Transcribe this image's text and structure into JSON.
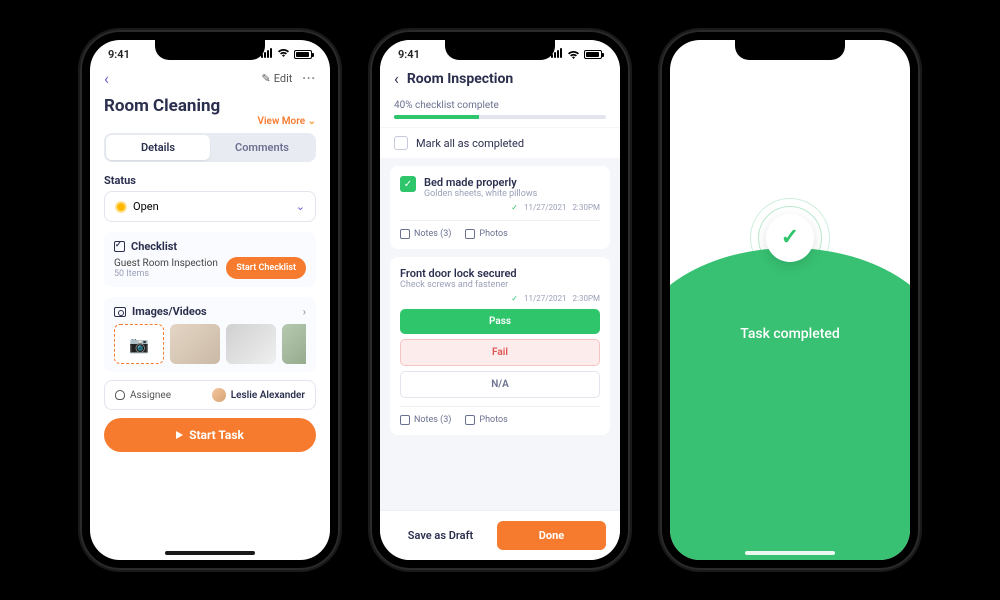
{
  "status_bar": {
    "time": "9:41"
  },
  "screen1": {
    "edit_label": "Edit",
    "title": "Room Cleaning",
    "view_more": "View More",
    "tabs": {
      "details": "Details",
      "comments": "Comments"
    },
    "status_label": "Status",
    "status_value": "Open",
    "checklist": {
      "header": "Checklist",
      "name": "Guest Room Inspection",
      "count": "50 Items",
      "button": "Start Checklist"
    },
    "media_header": "Images/Videos",
    "assignee_label": "Assignee",
    "assignee_name": "Leslie Alexander",
    "start_button": "Start Task"
  },
  "screen2": {
    "title": "Room Inspection",
    "progress_text": "40% checklist complete",
    "progress_pct": 40,
    "mark_all": "Mark all as completed",
    "item1": {
      "title": "Bed made properly",
      "sub": "Golden sheets, white pillows",
      "date": "11/27/2021",
      "time": "2:30PM"
    },
    "item2": {
      "title": "Front door lock secured",
      "sub": "Check screws and fastener",
      "date": "11/27/2021",
      "time": "2:30PM"
    },
    "notes_label": "Notes (3)",
    "photos_label": "Photos",
    "pass": "Pass",
    "fail": "Fail",
    "na": "N/A",
    "draft": "Save as Draft",
    "done": "Done"
  },
  "screen3": {
    "message": "Task completed"
  }
}
